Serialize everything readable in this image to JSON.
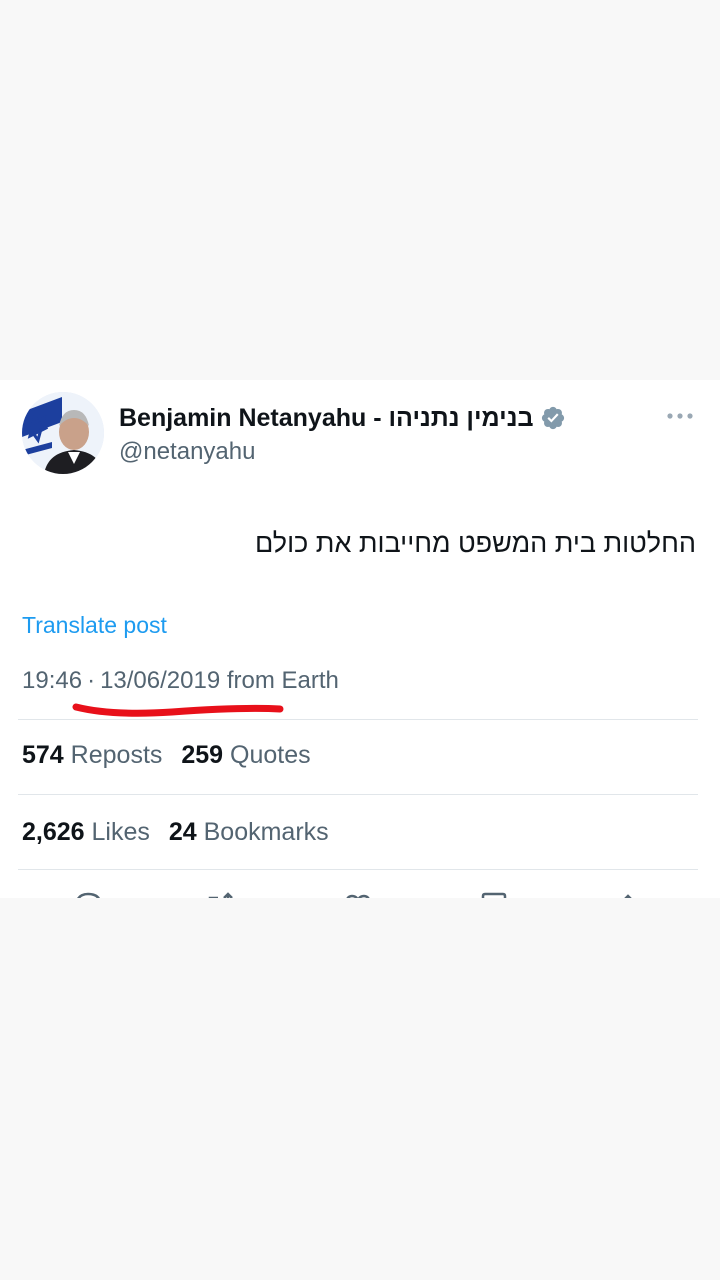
{
  "tweet": {
    "author_name": "Benjamin Netanyahu - בנימין נתניהו",
    "handle": "@netanyahu",
    "text": "החלטות בית המשפט מחייבות את כולם",
    "translate_label": "Translate post",
    "time": "19:46",
    "separator": "·",
    "date": "13/06/2019",
    "source": "from Earth"
  },
  "stats": {
    "reposts_count": "574",
    "reposts_label": "Reposts",
    "quotes_count": "259",
    "quotes_label": "Quotes",
    "likes_count": "2,626",
    "likes_label": "Likes",
    "bookmarks_count": "24",
    "bookmarks_label": "Bookmarks"
  },
  "icons": {
    "verified": "verified-badge-icon",
    "more": "more-options-icon",
    "actions": [
      "reply-icon",
      "repost-icon",
      "like-icon",
      "bookmark-icon",
      "share-icon"
    ]
  },
  "colors": {
    "link": "#1d9bf0",
    "secondary_text": "#536471",
    "primary_text": "#0f1419",
    "annotation": "#e8101a"
  }
}
